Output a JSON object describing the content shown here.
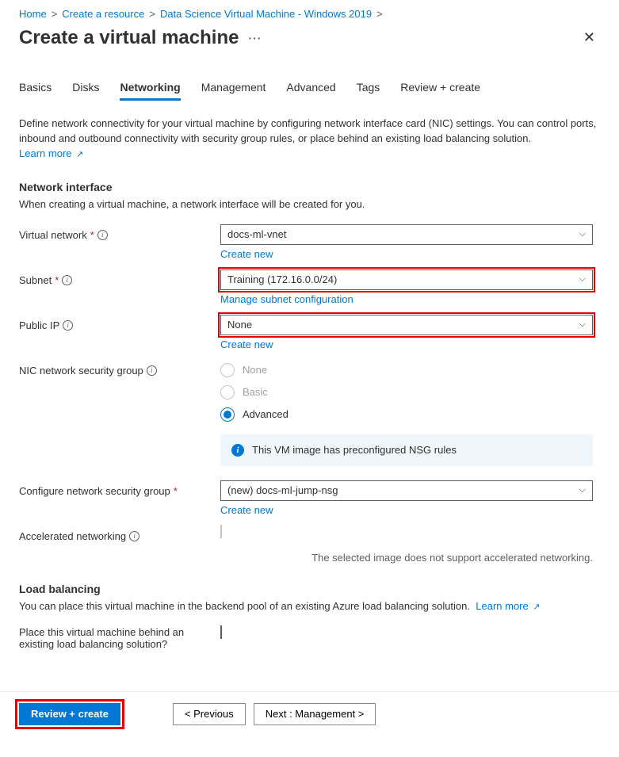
{
  "breadcrumb": {
    "items": [
      "Home",
      "Create a resource",
      "Data Science Virtual Machine - Windows 2019"
    ]
  },
  "header": {
    "title": "Create a virtual machine"
  },
  "tabs": {
    "items": [
      "Basics",
      "Disks",
      "Networking",
      "Management",
      "Advanced",
      "Tags",
      "Review + create"
    ],
    "active_index": 2
  },
  "intro": {
    "text": "Define network connectivity for your virtual machine by configuring network interface card (NIC) settings. You can control ports, inbound and outbound connectivity with security group rules, or place behind an existing load balancing solution.",
    "learn_more": "Learn more"
  },
  "network_interface": {
    "title": "Network interface",
    "desc": "When creating a virtual machine, a network interface will be created for you.",
    "virtual_network": {
      "label": "Virtual network",
      "value": "docs-ml-vnet",
      "create_new": "Create new"
    },
    "subnet": {
      "label": "Subnet",
      "value": "Training (172.16.0.0/24)",
      "manage": "Manage subnet configuration"
    },
    "public_ip": {
      "label": "Public IP",
      "value": "None",
      "create_new": "Create new"
    },
    "nsg": {
      "label": "NIC network security group",
      "options": [
        "None",
        "Basic",
        "Advanced"
      ],
      "selected_index": 2
    },
    "nsg_banner": "This VM image has preconfigured NSG rules",
    "configure_nsg": {
      "label": "Configure network security group",
      "value": "(new) docs-ml-jump-nsg",
      "create_new": "Create new"
    },
    "accelerated": {
      "label": "Accelerated networking",
      "helper": "The selected image does not support accelerated networking."
    }
  },
  "load_balancing": {
    "title": "Load balancing",
    "desc": "You can place this virtual machine in the backend pool of an existing Azure load balancing solution.",
    "learn_more": "Learn more",
    "place_label": "Place this virtual machine behind an existing load balancing solution?"
  },
  "footer": {
    "review": "Review + create",
    "previous": "<  Previous",
    "next": "Next : Management  >"
  }
}
